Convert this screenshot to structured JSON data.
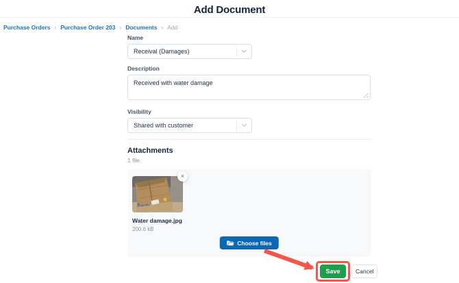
{
  "page": {
    "title": "Add Document"
  },
  "breadcrumb": {
    "separator": "›",
    "items": [
      {
        "label": "Purchase Orders"
      },
      {
        "label": "Purchase Order 203"
      },
      {
        "label": "Documents"
      },
      {
        "label": "Add"
      }
    ]
  },
  "form": {
    "name": {
      "label": "Name",
      "value": "Receival (Damages)"
    },
    "description": {
      "label": "Description",
      "value": "Received with water damage"
    },
    "visibility": {
      "label": "Visibility",
      "value": "Shared with customer"
    }
  },
  "attachments": {
    "heading": "Attachments",
    "count_text": "1 file",
    "files": [
      {
        "name": "Water damage.jpg",
        "size": "200.6 kB",
        "remove_glyph": "×"
      }
    ],
    "choose_files_label": "Choose files"
  },
  "actions": {
    "save_label": "Save",
    "cancel_label": "Cancel"
  },
  "colors": {
    "breadcrumb_link": "#1c72b9",
    "choose_files_blue": "#0e67b2",
    "save_green": "#1f9e4d",
    "annotation_red": "#f4564a",
    "panel_background": "#f7f8fa",
    "title_text": "#14233c"
  },
  "icons": {
    "chevron_down": "chevron-down",
    "folder_open": "folder-open",
    "close": "close",
    "resize_handle": "resize-handle"
  }
}
